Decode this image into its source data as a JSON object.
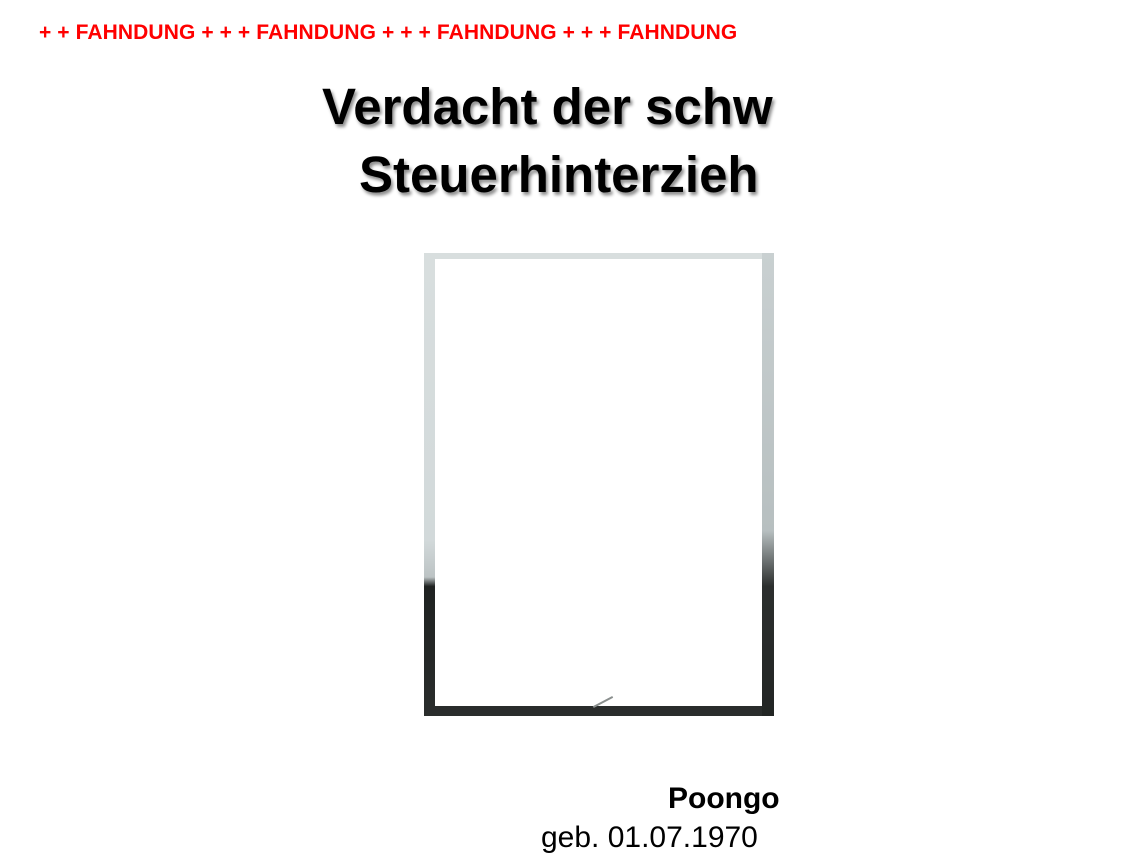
{
  "banner": {
    "text": "+ + FAHNDUNG + + + FAHNDUNG + + + FAHNDUNG + + + FAHNDUNG",
    "color": "#ff0000"
  },
  "headline": {
    "line1": "Verdacht der schw",
    "line2": "Steuerhinterzieh"
  },
  "person": {
    "name": "Poongo",
    "birth": "geb. 01.07.1970"
  }
}
